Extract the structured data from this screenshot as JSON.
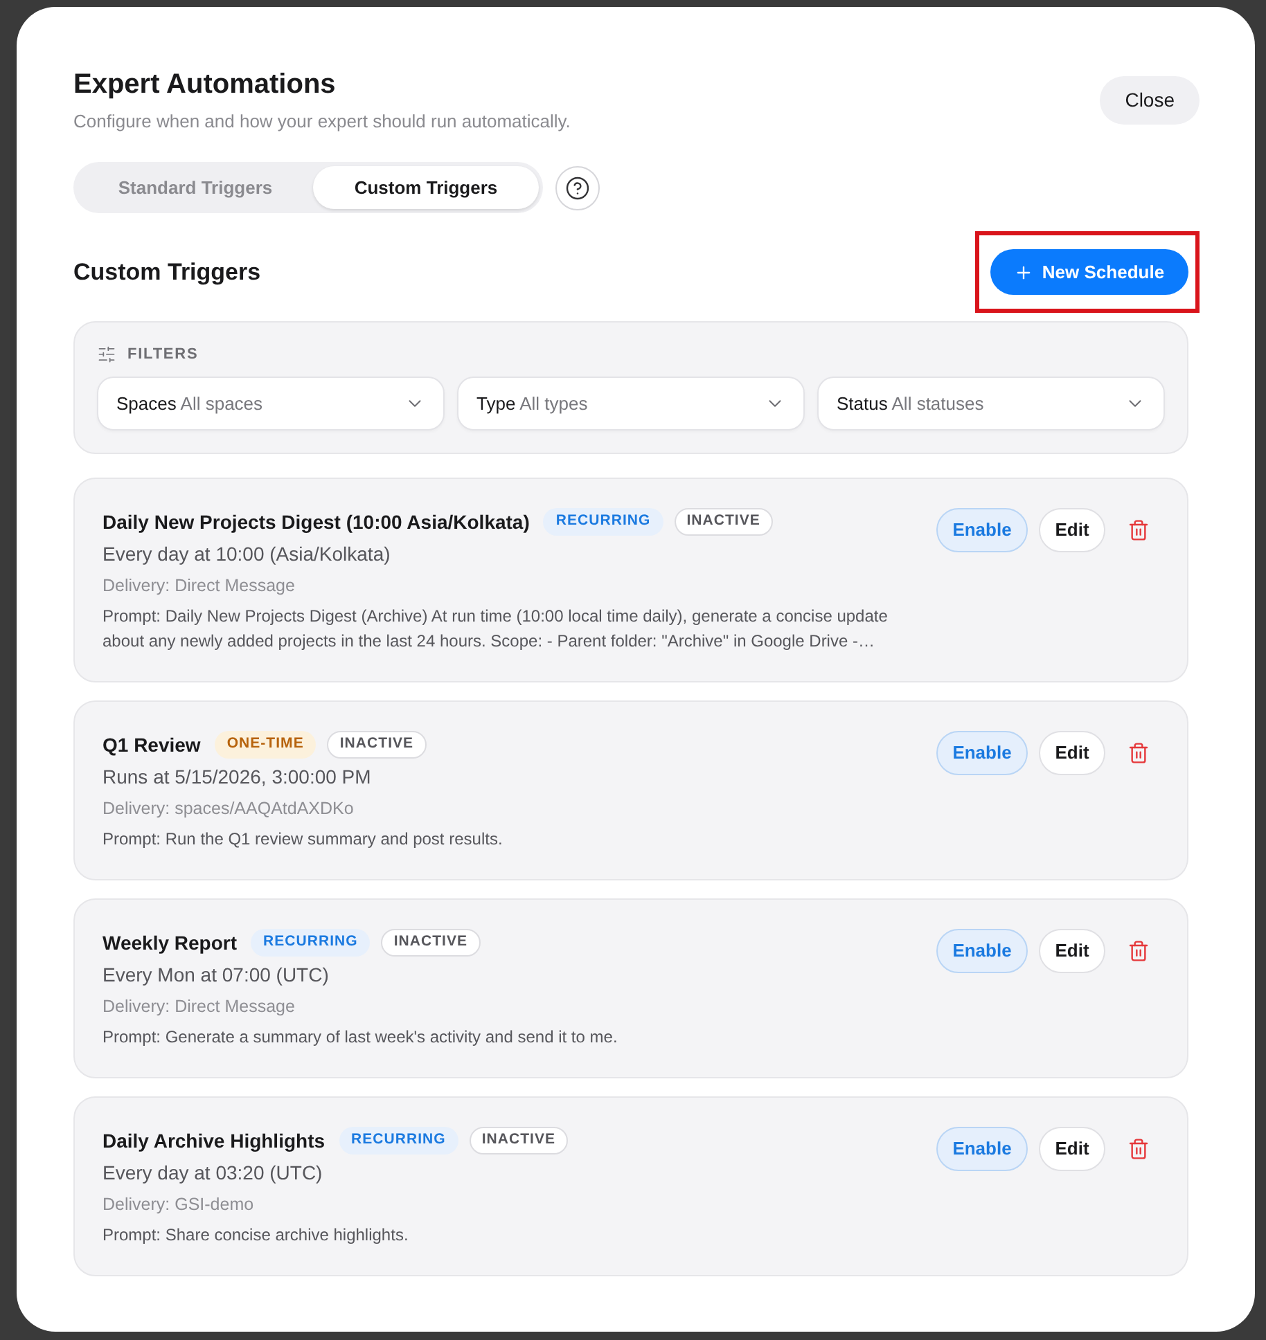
{
  "dialog": {
    "title": "Expert Automations",
    "subtitle": "Configure when and how your expert should run automatically.",
    "close_button": "Close"
  },
  "tabs": [
    {
      "label": "Standard Triggers",
      "selected": false
    },
    {
      "label": "Custom Triggers",
      "selected": true
    }
  ],
  "section": {
    "title": "Custom Triggers",
    "new_button": {
      "label": "New Schedule",
      "highlighted": true
    }
  },
  "filters": {
    "label": "FILTERS",
    "dropdowns": [
      {
        "label": "Spaces",
        "value": "All spaces"
      },
      {
        "label": "Type",
        "value": "All types"
      },
      {
        "label": "Status",
        "value": "All statuses"
      }
    ]
  },
  "triggers": [
    {
      "title": "Daily New Projects Digest (10:00 Asia/Kolkata)",
      "badges": [
        {
          "label": "RECURRING",
          "kind": "recurring"
        },
        {
          "label": "INACTIVE",
          "kind": "inactive"
        }
      ],
      "schedule": "Every day at 10:00 (Asia/Kolkata)",
      "delivery": "Delivery: Direct Message",
      "prompt": "Prompt: Daily New Projects Digest (Archive) At run time (10:00 local time daily), generate a concise update about any newly added projects in the last 24 hours. Scope: - Parent folder: \"Archive\" in Google Drive -…",
      "actions": {
        "enable": "Enable",
        "edit": "Edit"
      }
    },
    {
      "title": "Q1 Review",
      "badges": [
        {
          "label": "ONE-TIME",
          "kind": "one_time"
        },
        {
          "label": "INACTIVE",
          "kind": "inactive"
        }
      ],
      "schedule": "Runs at 5/15/2026, 3:00:00 PM",
      "delivery": "Delivery: spaces/AAQAtdAXDKo",
      "prompt": "Prompt: Run the Q1 review summary and post results.",
      "actions": {
        "enable": "Enable",
        "edit": "Edit"
      }
    },
    {
      "title": "Weekly Report",
      "badges": [
        {
          "label": "RECURRING",
          "kind": "recurring"
        },
        {
          "label": "INACTIVE",
          "kind": "inactive"
        }
      ],
      "schedule": "Every Mon at 07:00 (UTC)",
      "delivery": "Delivery: Direct Message",
      "prompt": "Prompt: Generate a summary of last week's activity and send it to me.",
      "actions": {
        "enable": "Enable",
        "edit": "Edit"
      }
    },
    {
      "title": "Daily Archive Highlights",
      "badges": [
        {
          "label": "RECURRING",
          "kind": "recurring"
        },
        {
          "label": "INACTIVE",
          "kind": "inactive"
        }
      ],
      "schedule": "Every day at 03:20 (UTC)",
      "delivery": "Delivery: GSI-demo",
      "prompt": "Prompt: Share concise archive highlights.",
      "actions": {
        "enable": "Enable",
        "edit": "Edit"
      }
    }
  ]
}
